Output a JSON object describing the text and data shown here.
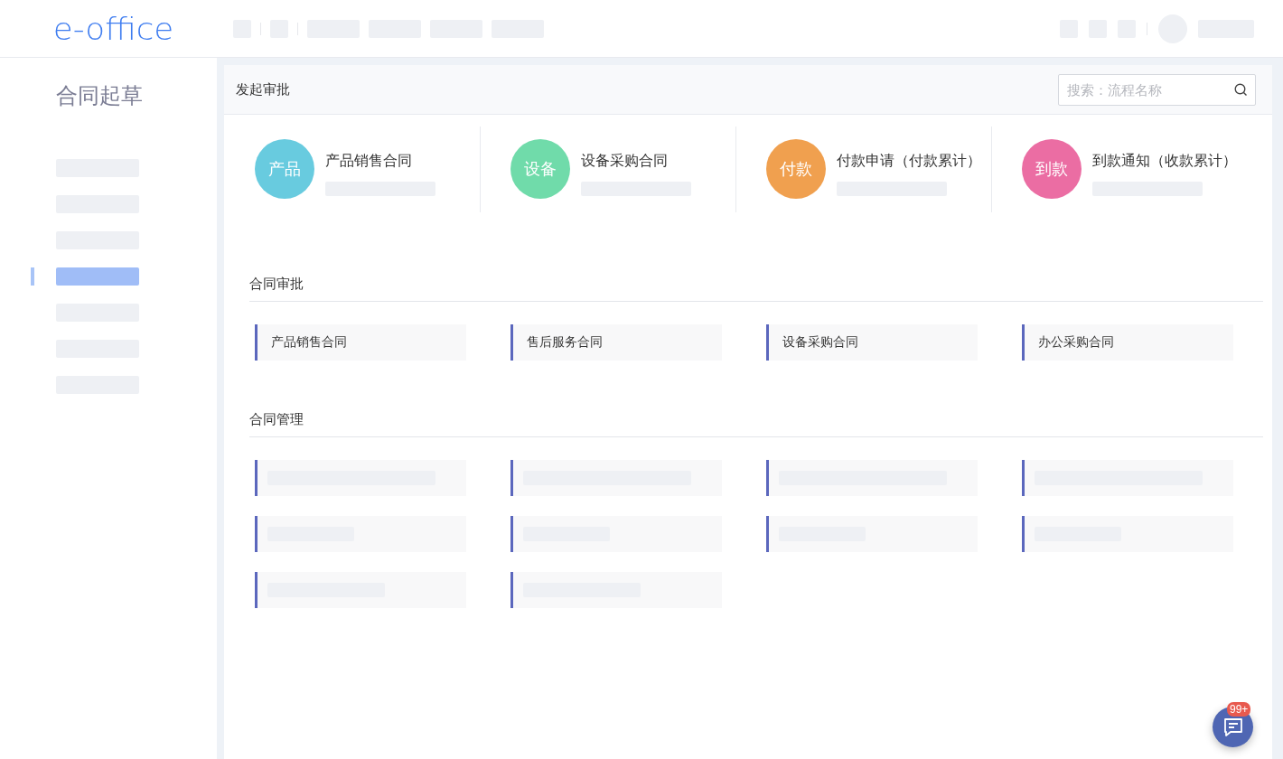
{
  "header": {
    "logo": "e-office"
  },
  "sidebar": {
    "title": "合同起草",
    "items": [
      {
        "selected": false
      },
      {
        "selected": false
      },
      {
        "selected": false
      },
      {
        "selected": true
      },
      {
        "selected": false
      },
      {
        "selected": false
      },
      {
        "selected": false
      }
    ]
  },
  "panel": {
    "title": "发起审批",
    "search": {
      "placeholder": "搜索：流程名称"
    }
  },
  "quick_start": [
    {
      "badge": "产品",
      "title": "产品销售合同",
      "color": "#68cbdf"
    },
    {
      "badge": "设备",
      "title": "设备采购合同",
      "color": "#70dbaa"
    },
    {
      "badge": "付款",
      "title": "付款申请（付款累计）",
      "color": "#f0a04f"
    },
    {
      "badge": "到款",
      "title": "到款通知（收款累计）",
      "color": "#eb6da3"
    }
  ],
  "sections": [
    {
      "title": "合同审批",
      "items": [
        {
          "label": "产品销售合同"
        },
        {
          "label": "售后服务合同"
        },
        {
          "label": "设备采购合同"
        },
        {
          "label": "办公采购合同"
        }
      ]
    },
    {
      "title": "合同管理",
      "items": [
        {
          "kind": "wide"
        },
        {
          "kind": "wide"
        },
        {
          "kind": "wide"
        },
        {
          "kind": "wide"
        },
        {
          "kind": "narrow"
        },
        {
          "kind": "narrow"
        },
        {
          "kind": "narrow"
        },
        {
          "kind": "narrow"
        },
        {
          "kind": "medium"
        },
        {
          "kind": "medium"
        }
      ]
    }
  ],
  "chat": {
    "badge": "99+"
  }
}
